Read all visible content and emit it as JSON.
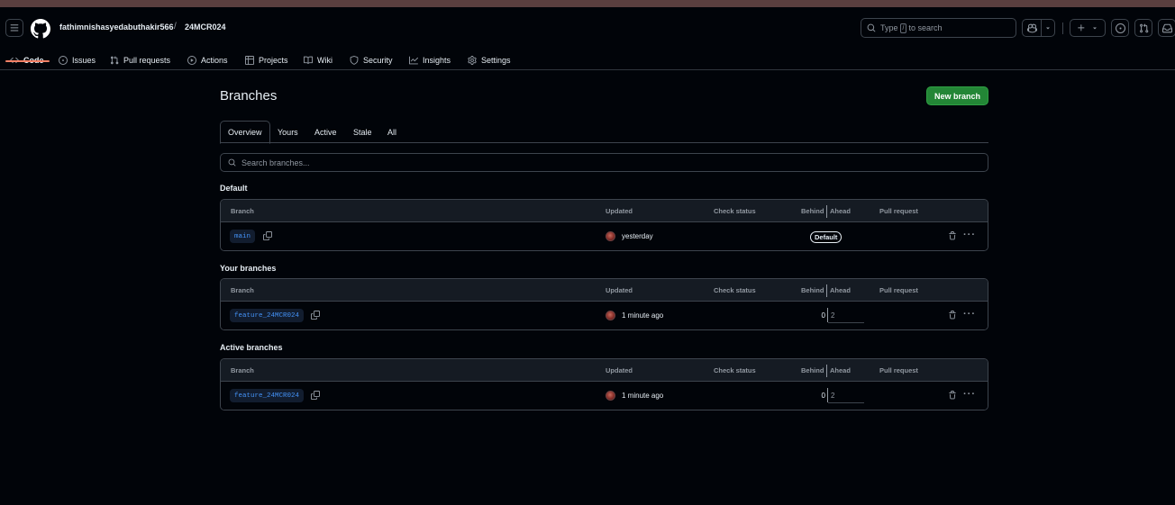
{
  "header": {
    "owner": "fathimnishasyedabuthakir566",
    "separator": "/",
    "repo": "24MCR024",
    "search_prefix": "Type",
    "search_key": "/",
    "search_suffix": "to search"
  },
  "repo_tabs": [
    {
      "label": "Code",
      "icon": "code-icon",
      "selected": true
    },
    {
      "label": "Issues",
      "icon": "issue-icon"
    },
    {
      "label": "Pull requests",
      "icon": "pull-request-icon"
    },
    {
      "label": "Actions",
      "icon": "play-icon"
    },
    {
      "label": "Projects",
      "icon": "table-icon"
    },
    {
      "label": "Wiki",
      "icon": "book-icon"
    },
    {
      "label": "Security",
      "icon": "shield-icon"
    },
    {
      "label": "Insights",
      "icon": "graph-icon"
    },
    {
      "label": "Settings",
      "icon": "gear-icon"
    }
  ],
  "page": {
    "title": "Branches",
    "new_branch_label": "New branch"
  },
  "subtabs": [
    "Overview",
    "Yours",
    "Active",
    "Stale",
    "All"
  ],
  "branch_search": {
    "placeholder": "Search branches..."
  },
  "columns": {
    "branch": "Branch",
    "updated": "Updated",
    "check_status": "Check status",
    "behind": "Behind",
    "ahead": "Ahead",
    "pull_request": "Pull request"
  },
  "sections": {
    "default": {
      "title": "Default",
      "rows": [
        {
          "name": "main",
          "updated": "yesterday",
          "badge": "Default"
        }
      ]
    },
    "yours": {
      "title": "Your branches",
      "rows": [
        {
          "name": "feature_24MCR024",
          "updated": "1 minute ago",
          "behind": "0",
          "ahead": "2"
        }
      ]
    },
    "active": {
      "title": "Active branches",
      "rows": [
        {
          "name": "feature_24MCR024",
          "updated": "1 minute ago",
          "behind": "0",
          "ahead": "2"
        }
      ]
    }
  },
  "colors": {
    "background": "#010409",
    "accent_green": "#238636",
    "link_blue": "#4493f8",
    "selected_underline": "#f78166"
  }
}
